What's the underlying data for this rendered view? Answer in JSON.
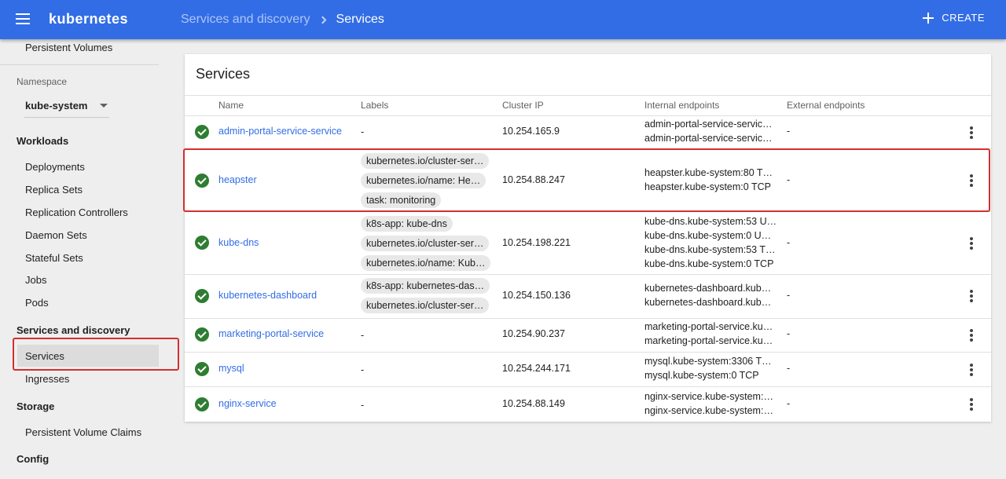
{
  "header": {
    "brand": "kubernetes",
    "breadcrumb_parent": "Services and discovery",
    "breadcrumb_current": "Services",
    "create_label": "CREATE"
  },
  "sidebar": {
    "top_item": "Persistent Volumes",
    "namespace_label": "Namespace",
    "namespace_value": "kube-system",
    "workloads_header": "Workloads",
    "workloads": [
      "Deployments",
      "Replica Sets",
      "Replication Controllers",
      "Daemon Sets",
      "Stateful Sets",
      "Jobs",
      "Pods"
    ],
    "discovery_header": "Services and discovery",
    "discovery": [
      "Services",
      "Ingresses"
    ],
    "storage_header": "Storage",
    "storage": [
      "Persistent Volume Claims"
    ],
    "config_header": "Config"
  },
  "card": {
    "title": "Services",
    "columns": [
      "Name",
      "Labels",
      "Cluster IP",
      "Internal endpoints",
      "External endpoints"
    ]
  },
  "rows": [
    {
      "name": "admin-portal-service-service",
      "labels_text": "-",
      "labels": [],
      "cluster_ip": "10.254.165.9",
      "endpoints": [
        "admin-portal-service-servic…",
        "admin-portal-service-servic…"
      ],
      "external": "-"
    },
    {
      "name": "heapster",
      "labels_text": "",
      "labels": [
        "kubernetes.io/cluster-ser…",
        "kubernetes.io/name: He…",
        "task: monitoring"
      ],
      "cluster_ip": "10.254.88.247",
      "endpoints": [
        "heapster.kube-system:80 T…",
        "heapster.kube-system:0 TCP"
      ],
      "external": "-"
    },
    {
      "name": "kube-dns",
      "labels_text": "",
      "labels": [
        "k8s-app: kube-dns",
        "kubernetes.io/cluster-ser…",
        "kubernetes.io/name: Kub…"
      ],
      "cluster_ip": "10.254.198.221",
      "endpoints": [
        "kube-dns.kube-system:53 U…",
        "kube-dns.kube-system:0 U…",
        "kube-dns.kube-system:53 T…",
        "kube-dns.kube-system:0 TCP"
      ],
      "external": "-"
    },
    {
      "name": "kubernetes-dashboard",
      "labels_text": "",
      "labels": [
        "k8s-app: kubernetes-das…",
        "kubernetes.io/cluster-ser…"
      ],
      "cluster_ip": "10.254.150.136",
      "endpoints": [
        "kubernetes-dashboard.kub…",
        "kubernetes-dashboard.kub…"
      ],
      "external": "-"
    },
    {
      "name": "marketing-portal-service",
      "labels_text": "-",
      "labels": [],
      "cluster_ip": "10.254.90.237",
      "endpoints": [
        "marketing-portal-service.ku…",
        "marketing-portal-service.ku…"
      ],
      "external": "-"
    },
    {
      "name": "mysql",
      "labels_text": "-",
      "labels": [],
      "cluster_ip": "10.254.244.171",
      "endpoints": [
        "mysql.kube-system:3306 T…",
        "mysql.kube-system:0 TCP"
      ],
      "external": "-"
    },
    {
      "name": "nginx-service",
      "labels_text": "-",
      "labels": [],
      "cluster_ip": "10.254.88.149",
      "endpoints": [
        "nginx-service.kube-system:…",
        "nginx-service.kube-system:…"
      ],
      "external": "-"
    }
  ],
  "icons": {
    "status": "check-circle-icon",
    "menu": "more-vert-icon",
    "nav": "menu-icon",
    "create": "plus-icon",
    "breadcrumb_separator": "chevron-right-icon"
  },
  "colors": {
    "primary": "#326de6",
    "success": "#2e7d32",
    "highlight": "#d32f2f"
  }
}
